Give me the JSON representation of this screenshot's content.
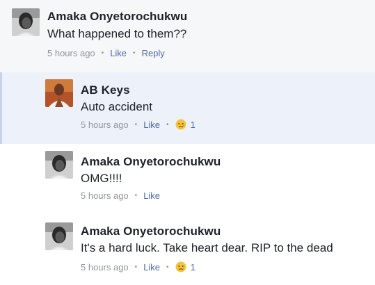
{
  "comments": [
    {
      "author": "Amaka Onyetorochukwu",
      "text": "What happened to them??",
      "time": "5 hours ago",
      "like_label": "Like",
      "reply_label": "Reply"
    },
    {
      "author": "AB Keys",
      "text": "Auto accident",
      "time": "5 hours ago",
      "like_label": "Like",
      "reaction_icon": "sad-face-icon",
      "reaction_count": "1"
    },
    {
      "author": "Amaka Onyetorochukwu",
      "text": "OMG!!!!",
      "time": "5 hours ago",
      "like_label": "Like"
    },
    {
      "author": "Amaka Onyetorochukwu",
      "text": "It's a hard luck. Take heart dear. RIP to the dead",
      "time": "5 hours ago",
      "like_label": "Like",
      "reaction_icon": "sad-face-icon",
      "reaction_count": "1"
    }
  ],
  "colors": {
    "link": "#4b6aa4",
    "meta": "#90949c",
    "text": "#1d2129",
    "highlight_bg": "#edf2fa"
  }
}
